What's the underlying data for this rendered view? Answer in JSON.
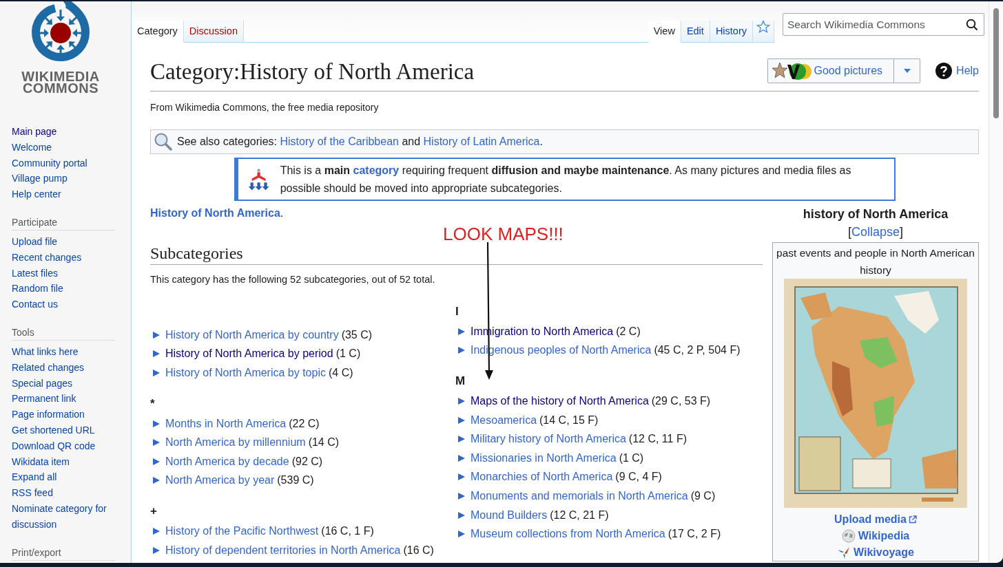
{
  "sidebar": {
    "wordmark": [
      "WIKIMEDIA",
      "COMMONS"
    ],
    "nav": [
      {
        "label": "Main page",
        "visited": true
      },
      {
        "label": "Welcome",
        "visited": false
      },
      {
        "label": "Community portal",
        "visited": false
      },
      {
        "label": "Village pump",
        "visited": false
      },
      {
        "label": "Help center",
        "visited": false
      }
    ],
    "sections": [
      {
        "title": "Participate",
        "items": [
          {
            "label": "Upload file",
            "visited": false
          },
          {
            "label": "Recent changes",
            "visited": false
          },
          {
            "label": "Latest files",
            "visited": false
          },
          {
            "label": "Random file",
            "visited": false
          },
          {
            "label": "Contact us",
            "visited": false
          }
        ]
      },
      {
        "title": "Tools",
        "items": [
          {
            "label": "What links here",
            "visited": false
          },
          {
            "label": "Related changes",
            "visited": false
          },
          {
            "label": "Special pages",
            "visited": false
          },
          {
            "label": "Permanent link",
            "visited": false
          },
          {
            "label": "Page information",
            "visited": false
          },
          {
            "label": "Get shortened URL",
            "visited": false
          },
          {
            "label": "Download QR code",
            "visited": false
          },
          {
            "label": "Wikidata item",
            "visited": false
          },
          {
            "label": "Expand all",
            "visited": false
          },
          {
            "label": "RSS feed",
            "visited": false
          },
          {
            "label": "Nominate category for discussion",
            "visited": false
          }
        ]
      },
      {
        "title": "Print/export"
      }
    ]
  },
  "namespace_tabs": [
    {
      "label": "Category",
      "selected": true,
      "missing": false
    },
    {
      "label": "Discussion",
      "selected": false,
      "missing": true
    }
  ],
  "view_tabs": [
    {
      "label": "View",
      "selected": true
    },
    {
      "label": "Edit",
      "selected": false
    },
    {
      "label": "History",
      "selected": false
    }
  ],
  "search": {
    "placeholder": "Search Wikimedia Commons"
  },
  "title": "Category:History of North America",
  "quality_button": "Good pictures",
  "help": "Help",
  "tagline": "From Wikimedia Commons, the free media repository",
  "see_also": [
    {
      "kind": "text",
      "text": "See also categories: "
    },
    {
      "kind": "link",
      "text": "History of the Caribbean"
    },
    {
      "kind": "text",
      "text": " and "
    },
    {
      "kind": "link",
      "text": "History of Latin America"
    },
    {
      "kind": "text",
      "text": "."
    }
  ],
  "notice": [
    {
      "kind": "text",
      "text": "This is a "
    },
    {
      "kind": "bold",
      "text": "main "
    },
    {
      "kind": "link",
      "text": "category"
    },
    {
      "kind": "text",
      "text": " requiring frequent "
    },
    {
      "kind": "bold",
      "text": "diffusion and maybe maintenance"
    },
    {
      "kind": "text",
      "text": ". As many pictures and media files as possible should be moved into appropriate subcategories."
    }
  ],
  "intro": {
    "link": "History of North America",
    "suffix": "."
  },
  "annotation": "LOOK MAPS!!!",
  "subcategories": {
    "heading": "Subcategories",
    "summary": "This category has the following 52 subcategories, out of 52 total.",
    "columns": [
      [
        {
          "items": [
            {
              "label": "History of North America by country",
              "count": "(35 C)",
              "visited": false
            },
            {
              "label": "History of North America by period",
              "count": "(1 C)",
              "visited": true
            },
            {
              "label": "History of North America by topic",
              "count": "(4 C)",
              "visited": false
            }
          ]
        },
        {
          "heading": "*",
          "items": [
            {
              "label": "Months in North America",
              "count": "(22 C)",
              "visited": false
            },
            {
              "label": "North America by millennium",
              "count": "(14 C)",
              "visited": false
            },
            {
              "label": "North America by decade",
              "count": "(92 C)",
              "visited": false
            },
            {
              "label": "North America by year",
              "count": "(539 C)",
              "visited": false
            }
          ]
        },
        {
          "heading": "+",
          "items": [
            {
              "label": "History of the Pacific Northwest",
              "count": "(16 C, 1 F)",
              "visited": false
            },
            {
              "label": "History of dependent territories in North America",
              "count": "(16 C)",
              "visited": false
            }
          ]
        }
      ],
      [
        {
          "heading": "I",
          "items": [
            {
              "label": "Immigration to North America",
              "count": "(2 C)",
              "visited": true
            },
            {
              "label": "Indigenous peoples of North America",
              "count": "(45 C, 2 P, 504 F)",
              "visited": false
            }
          ]
        },
        {
          "heading": "M",
          "items": [
            {
              "label": "Maps of the history of North America",
              "count": "(29 C, 53 F)",
              "visited": true
            },
            {
              "label": "Mesoamerica",
              "count": "(14 C, 15 F)",
              "visited": false
            },
            {
              "label": "Military history of North America",
              "count": "(12 C, 11 F)",
              "visited": false
            },
            {
              "label": "Missionaries in North America",
              "count": "(1 C)",
              "visited": false
            },
            {
              "label": "Monarchies of North America",
              "count": "(9 C, 4 F)",
              "visited": false
            },
            {
              "label": "Monuments and memorials in North America",
              "count": "(9 C)",
              "visited": false
            },
            {
              "label": "Mound Builders",
              "count": "(12 C, 21 F)",
              "visited": false
            },
            {
              "label": "Museum collections from North America",
              "count": "(17 C, 2 F)",
              "visited": false
            }
          ]
        }
      ]
    ]
  },
  "infobox": {
    "title": "history of North America",
    "collapse": {
      "before": "[",
      "link": "Collapse",
      "after": "]"
    },
    "description": "past events and people in North American history",
    "upload": "Upload media",
    "projects": [
      {
        "kind": "wikipedia",
        "label": "Wikipedia"
      },
      {
        "kind": "wikivoyage",
        "label": "Wikivoyage"
      }
    ]
  }
}
